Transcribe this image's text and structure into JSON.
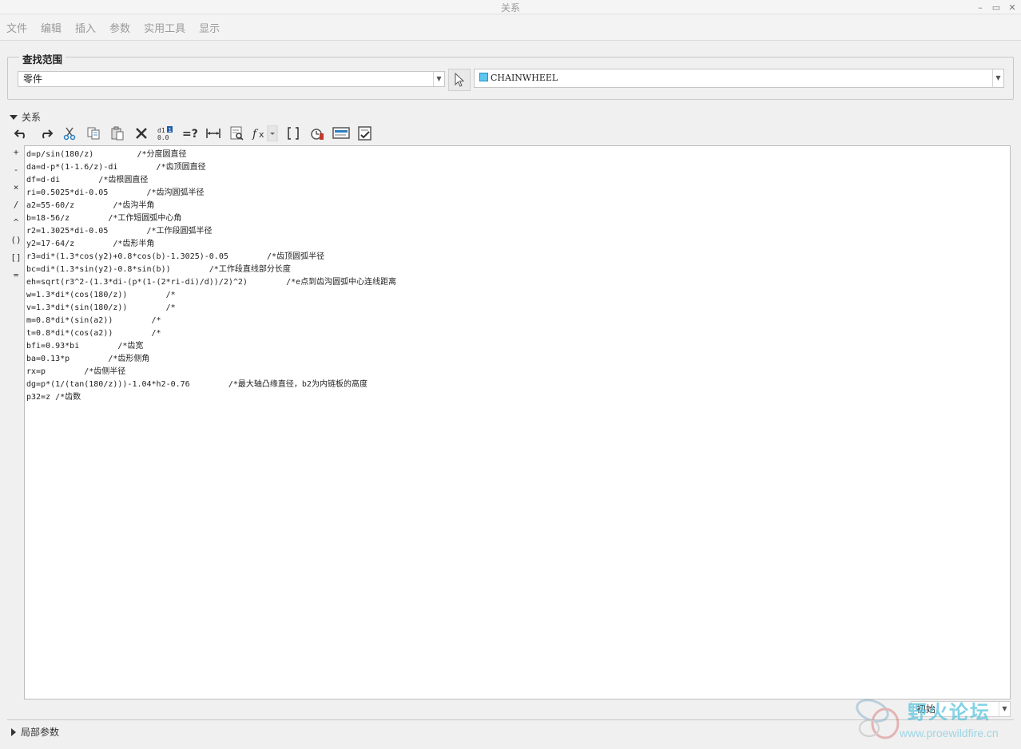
{
  "window": {
    "title": "关系",
    "controls": [
      "–",
      "▭",
      "✕"
    ]
  },
  "menu": [
    "文件",
    "编辑",
    "插入",
    "参数",
    "实用工具",
    "显示"
  ],
  "search_scope": {
    "legend": "查找范围",
    "type_value": "零件",
    "object_value": "CHAINWHEEL"
  },
  "relations_section": {
    "label": "关系"
  },
  "toolbar": [
    {
      "name": "undo-icon",
      "glyph": "↶"
    },
    {
      "name": "redo-icon",
      "glyph": "↷"
    },
    {
      "name": "cut-icon",
      "glyph": "✂"
    },
    {
      "name": "copy-icon",
      "glyph": "⎘"
    },
    {
      "name": "paste-icon",
      "glyph": "📋"
    },
    {
      "name": "delete-icon",
      "glyph": "✕"
    },
    {
      "name": "sort-icon",
      "glyph": "⇅"
    },
    {
      "name": "evaluate-icon",
      "glyph": "=?"
    },
    {
      "name": "dimension-icon",
      "glyph": "↔"
    },
    {
      "name": "parameter-search-icon",
      "glyph": "⌕"
    },
    {
      "name": "function-icon",
      "glyph": "fx"
    },
    {
      "name": "brackets-icon",
      "glyph": "[ ]"
    },
    {
      "name": "verify-icon",
      "glyph": "⏲"
    },
    {
      "name": "display-icon",
      "glyph": "▤"
    },
    {
      "name": "checklist-icon",
      "glyph": "☑"
    }
  ],
  "operators": [
    "+",
    "-",
    "×",
    "/",
    "^",
    "()",
    "[]",
    "="
  ],
  "relations": [
    "d=p/sin(180/z)         /*分度圆直径",
    "da=d-p*(1-1.6/z)-di        /*齿顶圆直径",
    "df=d-di        /*齿根圆直径",
    "ri=0.5025*di-0.05        /*齿沟圆弧半径",
    "a2=55-60/z        /*齿沟半角",
    "b=18-56/z        /*工作短圆弧中心角",
    "r2=1.3025*di-0.05        /*工作段圆弧半径",
    "y2=17-64/z        /*齿形半角",
    "r3=di*(1.3*cos(y2)+0.8*cos(b)-1.3025)-0.05        /*齿顶圆弧半径",
    "bc=di*(1.3*sin(y2)-0.8*sin(b))        /*工作段直线部分长度",
    "eh=sqrt(r3^2-(1.3*di-(p*(1-(2*ri-di)/d))/2)^2)        /*e点到齿沟圆弧中心连线距离",
    "w=1.3*di*(cos(180/z))        /*",
    "v=1.3*di*(sin(180/z))        /*",
    "m=0.8*di*(sin(a2))        /*",
    "t=0.8*di*(cos(a2))        /*",
    "bfi=0.93*bi        /*齿宽",
    "ba=0.13*p        /*齿形侧角",
    "rx=p        /*齿侧半径",
    "dg=p*(1/(tan(180/z)))-1.04*h2-0.76        /*最大轴凸缘直径，b2为内链板的高度",
    "p32=z /*齿数"
  ],
  "status": {
    "value": "初始"
  },
  "local_params_section": {
    "label": "局部参数"
  },
  "watermark": {
    "text_cn": "野火论坛",
    "url": "www.proewildfire.cn"
  }
}
